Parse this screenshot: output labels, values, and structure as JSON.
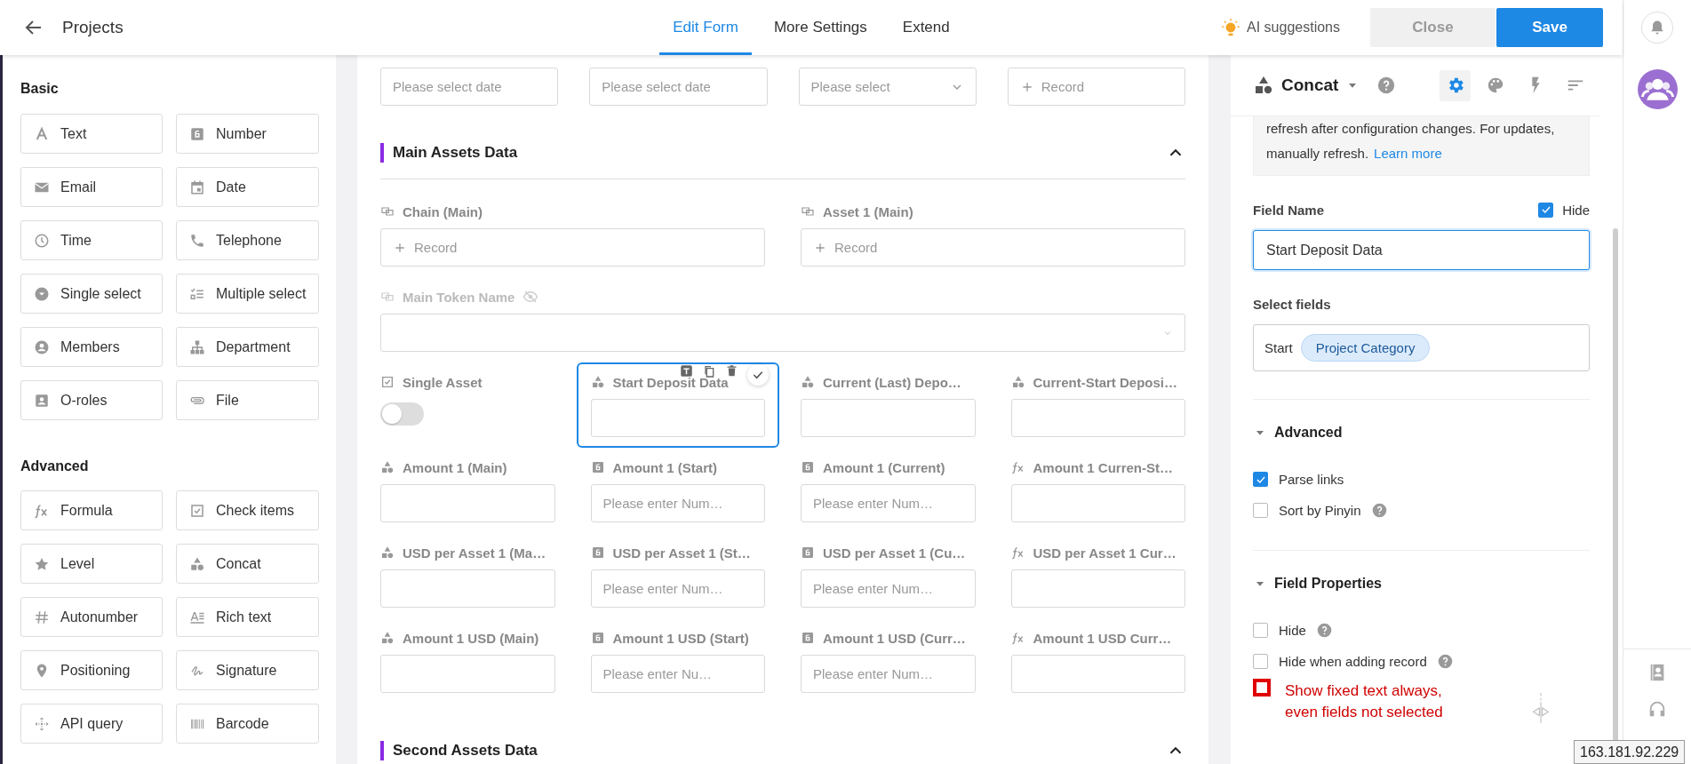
{
  "header": {
    "title": "Projects",
    "tabs": [
      {
        "label": "Edit Form",
        "selected": true
      },
      {
        "label": "More Settings",
        "selected": false
      },
      {
        "label": "Extend",
        "selected": false
      }
    ],
    "ai_suggestions": "AI suggestions",
    "buttons": [
      {
        "label": "Close",
        "kind": "secondary"
      },
      {
        "label": "Save",
        "kind": "primary"
      }
    ]
  },
  "palette": {
    "groups": [
      {
        "title": "Basic",
        "items": [
          {
            "label": "Text",
            "kind": "text"
          },
          {
            "label": "Number",
            "kind": "number"
          },
          {
            "label": "Email",
            "kind": "email"
          },
          {
            "label": "Date",
            "kind": "date"
          },
          {
            "label": "Time",
            "kind": "time"
          },
          {
            "label": "Telephone",
            "kind": "phone"
          },
          {
            "label": "Single select",
            "kind": "single_select"
          },
          {
            "label": "Multiple select",
            "kind": "multi_select"
          },
          {
            "label": "Members",
            "kind": "members"
          },
          {
            "label": "Department",
            "kind": "department"
          },
          {
            "label": "O-roles",
            "kind": "roles"
          },
          {
            "label": "File",
            "kind": "file"
          }
        ]
      },
      {
        "title": "Advanced",
        "items": [
          {
            "label": "Formula",
            "kind": "formula"
          },
          {
            "label": "Check items",
            "kind": "check_items"
          },
          {
            "label": "Level",
            "kind": "level"
          },
          {
            "label": "Concat",
            "kind": "concat"
          },
          {
            "label": "Autonumber",
            "kind": "autonumber"
          },
          {
            "label": "Rich text",
            "kind": "rich_text"
          },
          {
            "label": "Positioning",
            "kind": "pin"
          },
          {
            "label": "Signature",
            "kind": "signature"
          },
          {
            "label": "API query",
            "kind": "api"
          },
          {
            "label": "Barcode",
            "kind": "barcode"
          }
        ]
      }
    ]
  },
  "form": {
    "top_fields": [
      {
        "control": {
          "kind": "date",
          "placeholder": "Please select date"
        }
      },
      {
        "control": {
          "kind": "date",
          "placeholder": "Please select date"
        }
      },
      {
        "control": {
          "kind": "select",
          "placeholder": "Please select"
        }
      },
      {
        "control": {
          "kind": "record",
          "button": "Record"
        }
      }
    ],
    "sections": [
      {
        "title": "Main Assets Data",
        "expanded": true,
        "fields": [
          {
            "label": "Chain (Main)",
            "kind": "relation",
            "control": {
              "kind": "record",
              "button": "Record"
            },
            "hidden": false,
            "selected": false
          },
          {
            "label": "Asset 1 (Main)",
            "kind": "relation",
            "control": {
              "kind": "record",
              "button": "Record"
            },
            "hidden": false,
            "selected": false
          },
          {
            "label": "Main Token Name",
            "kind": "relation",
            "control": {
              "kind": "dropdown"
            },
            "hidden": true,
            "selected": false
          },
          {
            "label": "Single Asset",
            "kind": "checkbox",
            "control": {
              "kind": "toggle",
              "on": false
            },
            "hidden": false,
            "selected": false
          },
          {
            "label": "Start Deposit Data",
            "kind": "concat",
            "control": {
              "kind": "input"
            },
            "hidden": false,
            "selected": true
          },
          {
            "label": "Current (Last) Depo…",
            "kind": "concat",
            "control": {
              "kind": "input"
            },
            "hidden": false,
            "selected": false
          },
          {
            "label": "Current-Start Deposi…",
            "kind": "concat",
            "control": {
              "kind": "input"
            },
            "hidden": false,
            "selected": false
          },
          {
            "label": "Amount 1 (Main)",
            "kind": "concat",
            "control": {
              "kind": "input"
            },
            "hidden": false,
            "selected": false
          },
          {
            "label": "Amount 1 (Start)",
            "kind": "number",
            "control": {
              "kind": "input",
              "placeholder": "Please enter Num…"
            },
            "hidden": false,
            "selected": false
          },
          {
            "label": "Amount 1 (Current)",
            "kind": "number",
            "control": {
              "kind": "input",
              "placeholder": "Please enter Num…"
            },
            "hidden": false,
            "selected": false
          },
          {
            "label": "Amount 1 Curren-St…",
            "kind": "formula",
            "control": {
              "kind": "input"
            },
            "hidden": false,
            "selected": false
          },
          {
            "label": "USD per Asset 1 (Ma…",
            "kind": "concat",
            "control": {
              "kind": "input"
            },
            "hidden": false,
            "selected": false
          },
          {
            "label": "USD per Asset 1 (St…",
            "kind": "number",
            "control": {
              "kind": "input",
              "placeholder": "Please enter Num…"
            },
            "hidden": false,
            "selected": false
          },
          {
            "label": "USD per Asset 1 (Cu…",
            "kind": "number",
            "control": {
              "kind": "input",
              "placeholder": "Please enter Num…"
            },
            "hidden": false,
            "selected": false
          },
          {
            "label": "USD per Asset 1 Cur…",
            "kind": "formula",
            "control": {
              "kind": "input"
            },
            "hidden": false,
            "selected": false
          },
          {
            "label": "Amount 1 USD (Main)",
            "kind": "concat",
            "control": {
              "kind": "input"
            },
            "hidden": false,
            "selected": false
          },
          {
            "label": "Amount 1 USD (Start)",
            "kind": "number",
            "control": {
              "kind": "input",
              "placeholder": "Please enter Nu…"
            },
            "hidden": false,
            "selected": false
          },
          {
            "label": "Amount 1 USD (Curr…",
            "kind": "number",
            "control": {
              "kind": "input",
              "placeholder": "Please enter Num…"
            },
            "hidden": false,
            "selected": false
          },
          {
            "label": "Amount 1 USD Curr…",
            "kind": "formula",
            "control": {
              "kind": "input"
            },
            "hidden": false,
            "selected": false
          }
        ]
      },
      {
        "title": "Second Assets Data",
        "expanded": true
      }
    ]
  },
  "settings": {
    "field_type": "Concat",
    "tool_tabs": [
      {
        "kind": "gear",
        "selected": true
      },
      {
        "kind": "palette",
        "selected": false
      },
      {
        "kind": "bolt",
        "selected": false
      },
      {
        "kind": "sort",
        "selected": false
      }
    ],
    "notice": {
      "text": "refresh after configuration changes. For updates, manually refresh.",
      "link": "Learn more"
    },
    "field_name": {
      "label": "Field Name",
      "hide_label": "Hide",
      "hide_checked": true,
      "value": "Start Deposit Data"
    },
    "select_fields": {
      "label": "Select fields",
      "text": "Start",
      "chips": [
        "Project Category"
      ]
    },
    "groups": [
      {
        "title": "Advanced",
        "expanded": true,
        "options": [
          {
            "kind": "checkbox",
            "label": "Parse links",
            "checked": true,
            "help": false
          },
          {
            "kind": "checkbox",
            "label": "Sort by Pinyin",
            "checked": false,
            "help": true
          }
        ]
      },
      {
        "title": "Field Properties",
        "expanded": true,
        "options": [
          {
            "kind": "checkbox",
            "label": "Hide",
            "checked": false,
            "help": true
          },
          {
            "kind": "checkbox",
            "label": "Hide when adding record",
            "checked": false,
            "help": true
          },
          {
            "kind": "annotation",
            "label": "Show fixed text always, even fields not selected"
          }
        ]
      }
    ]
  },
  "tooltip": "163.181.92.229"
}
